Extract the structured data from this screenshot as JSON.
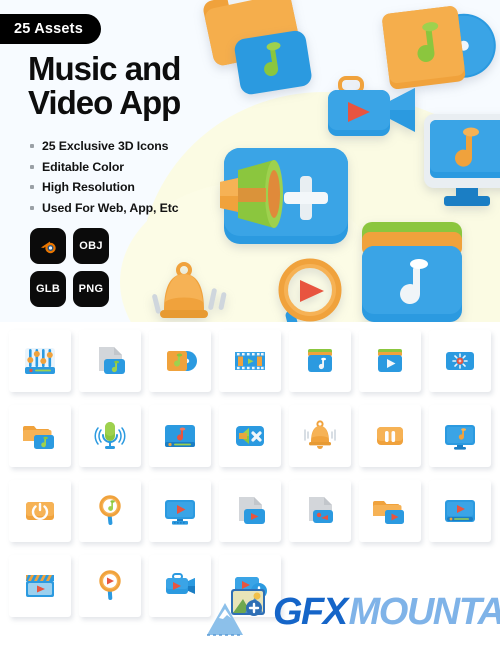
{
  "badge": {
    "label": "25 Assets"
  },
  "hero": {
    "title_line1": "Music and",
    "title_line2": "Video App",
    "bg_color": "#f7fbff",
    "blob_color": "#fbfbe3",
    "features": [
      {
        "label": "25 Exclusive 3D Icons"
      },
      {
        "label": "Editable Color"
      },
      {
        "label": "High Resolution"
      },
      {
        "label": "Used For Web, App, Etc"
      }
    ],
    "formats": [
      {
        "label": "",
        "icon": "blender-icon",
        "name": "blender"
      },
      {
        "label": "OBJ",
        "icon": "text-badge",
        "name": "obj"
      },
      {
        "label": "GLB",
        "icon": "text-badge",
        "name": "glb"
      },
      {
        "label": "PNG",
        "icon": "text-badge",
        "name": "png"
      }
    ],
    "art": [
      {
        "name": "music-folder-3d"
      },
      {
        "name": "music-album-3d"
      },
      {
        "name": "video-camera-3d"
      },
      {
        "name": "megaphone-add-3d"
      },
      {
        "name": "music-monitor-3d"
      },
      {
        "name": "notification-bell-3d"
      },
      {
        "name": "video-search-3d"
      },
      {
        "name": "music-playlist-3d"
      }
    ]
  },
  "palette": {
    "blue": "#2b9ae0",
    "blue_dark": "#1b7ec4",
    "orange": "#f0a23c",
    "orange_dark": "#d98524",
    "green": "#8bc63e",
    "red": "#e8543f",
    "grey": "#d3d6da",
    "white": "#ffffff"
  },
  "grid": {
    "rows": 4,
    "columns": 7,
    "icons": [
      {
        "name": "equalizer-icon",
        "label": "Equalizer"
      },
      {
        "name": "music-file-icon",
        "label": "Music File"
      },
      {
        "name": "music-album-icon",
        "label": "Music Album"
      },
      {
        "name": "film-strip-icon",
        "label": "Film Strip"
      },
      {
        "name": "music-playlist-icon",
        "label": "Music Playlist"
      },
      {
        "name": "video-playlist-icon",
        "label": "Video Playlist"
      },
      {
        "name": "music-loading-icon",
        "label": "Music Loading"
      },
      {
        "name": "music-folder-icon",
        "label": "Music Folder"
      },
      {
        "name": "microphone-icon",
        "label": "Microphone"
      },
      {
        "name": "music-player-icon",
        "label": "Music Player"
      },
      {
        "name": "mute-icon",
        "label": "Mute"
      },
      {
        "name": "bell-icon",
        "label": "Notification Bell"
      },
      {
        "name": "pause-icon",
        "label": "Pause"
      },
      {
        "name": "music-monitor-icon",
        "label": "Music Monitor"
      },
      {
        "name": "power-icon",
        "label": "Power"
      },
      {
        "name": "music-search-icon",
        "label": "Music Search"
      },
      {
        "name": "video-monitor-icon",
        "label": "Video Monitor"
      },
      {
        "name": "video-file-icon",
        "label": "Video File"
      },
      {
        "name": "video-document-icon",
        "label": "Video Document"
      },
      {
        "name": "video-folder-icon",
        "label": "Video Folder"
      },
      {
        "name": "video-player-icon",
        "label": "Video Player"
      },
      {
        "name": "clapperboard-icon",
        "label": "Clapperboard"
      },
      {
        "name": "video-search-icon",
        "label": "Video Search"
      },
      {
        "name": "video-camera-icon",
        "label": "Video Camera"
      },
      {
        "name": "add-video-icon",
        "label": "Add Video"
      }
    ]
  },
  "watermark": {
    "text_primary": "GFX",
    "text_secondary": "MOUNTAIN",
    "color_primary": "#1565c8",
    "color_secondary": "#7fb3e8"
  }
}
